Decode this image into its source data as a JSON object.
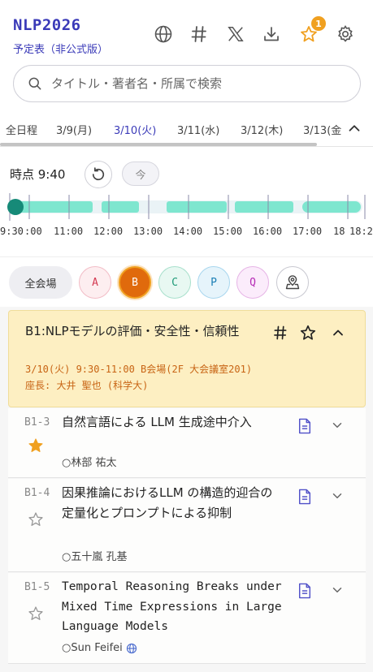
{
  "header": {
    "title": "NLP2026",
    "subtitle": "予定表（非公式版）",
    "icons": [
      "globe-icon",
      "hash-icon",
      "x-logo-icon",
      "download-icon",
      "star-icon",
      "gear-icon"
    ],
    "favorites_count": "1"
  },
  "search": {
    "placeholder": "タイトル・著者名・所属で検索"
  },
  "date_tabs": [
    {
      "label": "全日程"
    },
    {
      "label": "3/9(月)"
    },
    {
      "label": "3/10(火)",
      "active": true
    },
    {
      "label": "3/11(水)"
    },
    {
      "label": "3/12(木)"
    },
    {
      "label": "3/13(金"
    }
  ],
  "time": {
    "label": "時点 9:40",
    "now_label": "今",
    "ticks": [
      ":30",
      ":00",
      "11:00",
      "12:00",
      "13:00",
      "14:00",
      "15:00",
      "16:00",
      "17:00",
      "18",
      "18:2"
    ],
    "tick_prefix": "9"
  },
  "venues": {
    "all_label": "全会場",
    "items": [
      {
        "label": "A",
        "color": "#d43a52",
        "bg": "#fdeef0"
      },
      {
        "label": "B",
        "color": "#ffffff",
        "bg": "#e06a0c",
        "selected": true
      },
      {
        "label": "C",
        "color": "#1e9a78",
        "bg": "#e8f8f2"
      },
      {
        "label": "P",
        "color": "#1b7fb5",
        "bg": "#e6f4fb"
      },
      {
        "label": "Q",
        "color": "#b52bb5",
        "bg": "#fbecfb"
      }
    ]
  },
  "session": {
    "title": "B1:NLPモデルの評価・安全性・信頼性",
    "time_venue": "3/10(火) 9:30-11:00 B会場(2F 大会議室201)",
    "chair": "座長: 大井 聖也 (科学大)"
  },
  "papers": [
    {
      "id": "B1-3",
      "title": "自然言語による LLM 生成途中介入",
      "authors": "○林部 祐太",
      "starred": true,
      "intl": false
    },
    {
      "id": "B1-4",
      "title": "因果推論におけるLLM の構造的迎合の定量化とプロンプトによる抑制",
      "authors": "○五十嵐 孔基",
      "starred": false,
      "intl": false
    },
    {
      "id": "B1-5",
      "title": "Temporal Reasoning Breaks under Mixed Time Expressions in Large Language Models",
      "authors": "○Sun Feifei",
      "starred": false,
      "intl": true
    }
  ],
  "colors": {
    "accent": "#3a3ab8",
    "timeline_fill": "#7ee6cf",
    "timeline_marker": "#168a78",
    "session_bg": "#fdefc2",
    "session_meta": "#c86414",
    "star_filled": "#f0a020"
  }
}
